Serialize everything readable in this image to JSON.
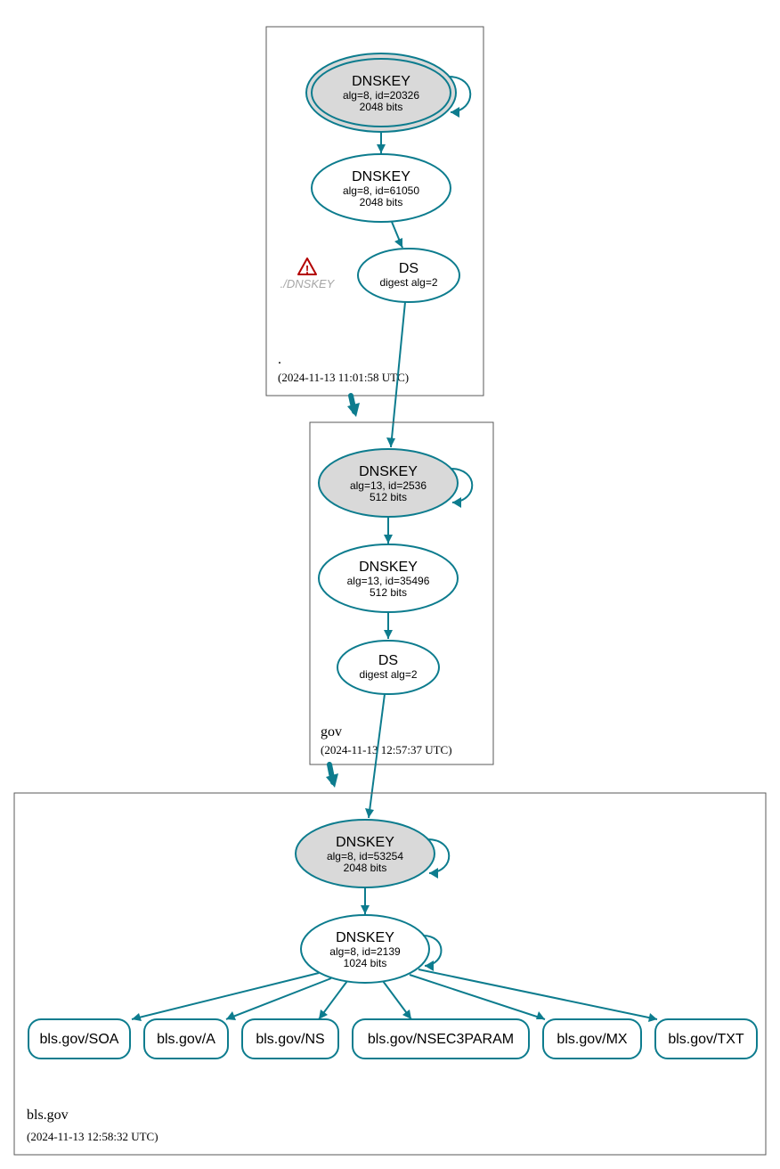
{
  "colors": {
    "stroke": "#0d7c8e",
    "box": "#595959",
    "fill_grey": "#d9d9d9",
    "warn": "#b30000",
    "missing": "#a6a6a6"
  },
  "zones": {
    "root": {
      "name": ".",
      "timestamp": "(2024-11-13 11:01:58 UTC)",
      "nodes": {
        "ksk": {
          "title": "DNSKEY",
          "line1": "alg=8, id=20326",
          "line2": "2048 bits"
        },
        "zsk": {
          "title": "DNSKEY",
          "line1": "alg=8, id=61050",
          "line2": "2048 bits"
        },
        "ds": {
          "title": "DS",
          "line1": "digest alg=2"
        },
        "missing": "./DNSKEY"
      }
    },
    "gov": {
      "name": "gov",
      "timestamp": "(2024-11-13 12:57:37 UTC)",
      "nodes": {
        "ksk": {
          "title": "DNSKEY",
          "line1": "alg=13, id=2536",
          "line2": "512 bits"
        },
        "zsk": {
          "title": "DNSKEY",
          "line1": "alg=13, id=35496",
          "line2": "512 bits"
        },
        "ds": {
          "title": "DS",
          "line1": "digest alg=2"
        }
      }
    },
    "bls": {
      "name": "bls.gov",
      "timestamp": "(2024-11-13 12:58:32 UTC)",
      "nodes": {
        "ksk": {
          "title": "DNSKEY",
          "line1": "alg=8, id=53254",
          "line2": "2048 bits"
        },
        "zsk": {
          "title": "DNSKEY",
          "line1": "alg=8, id=2139",
          "line2": "1024 bits"
        }
      },
      "rrsets": {
        "soa": "bls.gov/SOA",
        "a": "bls.gov/A",
        "ns": "bls.gov/NS",
        "nsec3param": "bls.gov/NSEC3PARAM",
        "mx": "bls.gov/MX",
        "txt": "bls.gov/TXT"
      }
    }
  }
}
